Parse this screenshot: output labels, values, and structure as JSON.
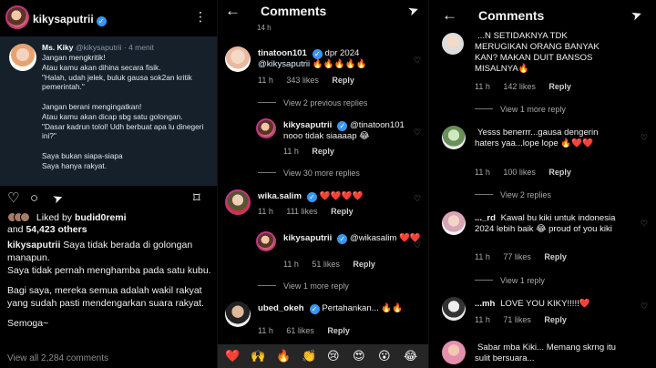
{
  "panel1": {
    "username": "kikysaputrii",
    "tweet": {
      "name": "Ms. Kiky",
      "handle_time": "@kikysaputrii · 4 menit",
      "body": "Jangan mengkritik!\nAtau kamu akan dihina secara fisik.\n\"Halah, udah jelek, buluk gausa sok2an kritik pemerintah.\"\n\nJangan berani mengingatkan!\nAtau kamu akan dicap sbg satu golongan.\n\"Dasar kadrun tolol! Udh berbuat apa lu dinegeri ini?\"\n\nSaya bukan siapa-siapa\nSaya hanya rakyat."
    },
    "likes_prefix": "Liked by",
    "liked_by_user": "budid0remi",
    "likes_and": "and",
    "likes_count": "54,423 others",
    "caption_user": "kikysaputrii",
    "caption_lines": [
      "Saya tidak berada di golongan manapun.",
      "Saya tidak pernah menghamba pada satu kubu.",
      "Bagi saya, mereka semua adalah wakil rakyat yang sudah pasti mendengarkan suara rakyat.",
      "Semoga~"
    ],
    "view_all": "View all 2,284 comments"
  },
  "panel2": {
    "title": "Comments",
    "top_time": "14 h",
    "comments": [
      {
        "user": "tinatoon101",
        "badge": "dpr 2024",
        "text": "@kikysaputrii 🔥🔥🔥🔥🔥",
        "time": "11 h",
        "likes": "343 likes",
        "reply": "Reply"
      },
      {
        "view": "View 2 previous replies"
      },
      {
        "user": "kikysaputrii",
        "text": "@tinatoon101 nooo tidak siaaaap 😂",
        "time": "11 h",
        "likes": "",
        "reply": "Reply"
      },
      {
        "view": "View 30 more replies"
      },
      {
        "user": "wika.salim",
        "text": "❤️❤️❤️❤️",
        "time": "11 h",
        "likes": "111 likes",
        "reply": "Reply"
      },
      {
        "user": "kikysaputrii",
        "text": "@wikasalim ❤️❤️",
        "time": "11 h",
        "likes": "51 likes",
        "reply": "Reply"
      },
      {
        "view": "View 1 more reply"
      },
      {
        "user": "ubed_okeh",
        "text": "Pertahankan... 🔥🔥",
        "time": "11 h",
        "likes": "61 likes",
        "reply": "Reply"
      }
    ],
    "emojis": [
      "❤️",
      "🙌",
      "🔥",
      "👏",
      "😢",
      "😍",
      "😮",
      "😂"
    ]
  },
  "panel3": {
    "title": "Comments",
    "comments": [
      {
        "user": "",
        "text": "...N SETIDAKNYA TDK MERUGIKAN ORANG BANYAK KAN? MAKAN DUIT BANSOS MISALNYA🔥",
        "time": "11 h",
        "likes": "142 likes",
        "reply": "Reply"
      },
      {
        "view": "View 1 more reply"
      },
      {
        "user": "",
        "text": "Yesss benerrr...gausa dengerin haters yaa...lope lope 🔥❤️❤️",
        "time": "11 h",
        "likes": "100 likes",
        "reply": "Reply"
      },
      {
        "view": "View 2 replies"
      },
      {
        "user": "..._rd",
        "text": "Kawal bu kiki untuk indonesia 2024 lebih baik 😂 proud of you kiki",
        "time": "11 h",
        "likes": "77 likes",
        "reply": "Reply"
      },
      {
        "view": "View 1 reply"
      },
      {
        "user": "...mh",
        "text": "LOVE YOU KIKY!!!!!❤️",
        "time": "11 h",
        "likes": "71 likes",
        "reply": "Reply"
      },
      {
        "user": "",
        "text": "Sabar mba Kiki... Memang skrng itu sulit bersuara...",
        "time": "",
        "likes": "",
        "reply": ""
      }
    ]
  },
  "colors": {
    "bg": "#000000",
    "tweet_bg": "#15202b",
    "verified": "#3897f0",
    "muted": "#a8a8a8"
  }
}
